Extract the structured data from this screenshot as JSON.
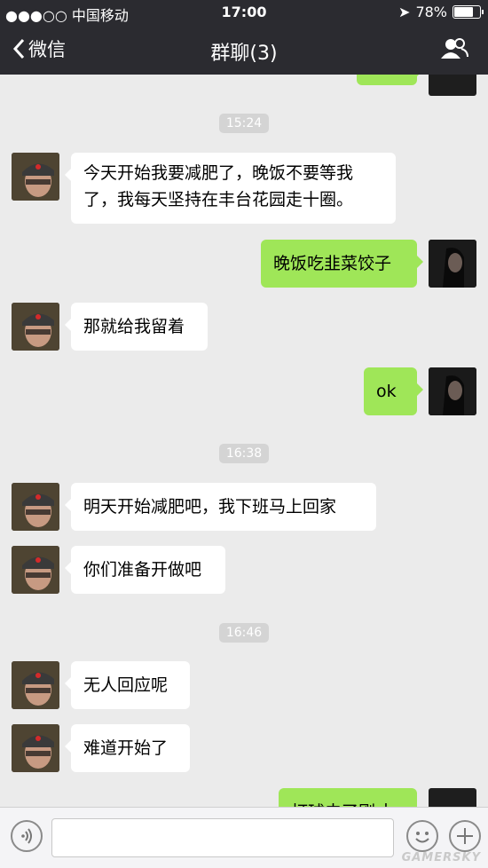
{
  "status_bar": {
    "carrier": "●●●○○ 中国移动",
    "time": "17:00",
    "battery": "78%"
  },
  "nav": {
    "back_label": "微信",
    "title": "群聊(3)"
  },
  "messages": [
    {
      "type": "time",
      "text": "15:24"
    },
    {
      "type": "in",
      "text": "今天开始我要减肥了，晚饭不要等我了，我每天坚持在丰台花园走十圈。"
    },
    {
      "type": "out",
      "text": "晚饭吃韭菜饺子"
    },
    {
      "type": "in",
      "text": "那就给我留着"
    },
    {
      "type": "out",
      "text": "ok"
    },
    {
      "type": "time",
      "text": "16:38"
    },
    {
      "type": "in",
      "text": "明天开始减肥吧，我下班马上回家"
    },
    {
      "type": "in",
      "text": "你们准备开做吧"
    },
    {
      "type": "time",
      "text": "16:46"
    },
    {
      "type": "in",
      "text": "无人回应呢"
    },
    {
      "type": "in",
      "text": "难道开始了"
    },
    {
      "type": "out",
      "text": "打球去了刚才"
    }
  ],
  "watermark": "GAMERSKY",
  "colors": {
    "nav_bg": "#2b2b30",
    "chat_bg": "#ebebeb",
    "out_bubble": "#9fe658",
    "in_bubble": "#ffffff"
  },
  "icons": [
    "back-chevron-icon",
    "contacts-icon",
    "voice-icon",
    "emoji-icon",
    "plus-icon",
    "wifi-icon",
    "location-icon",
    "battery-icon"
  ]
}
